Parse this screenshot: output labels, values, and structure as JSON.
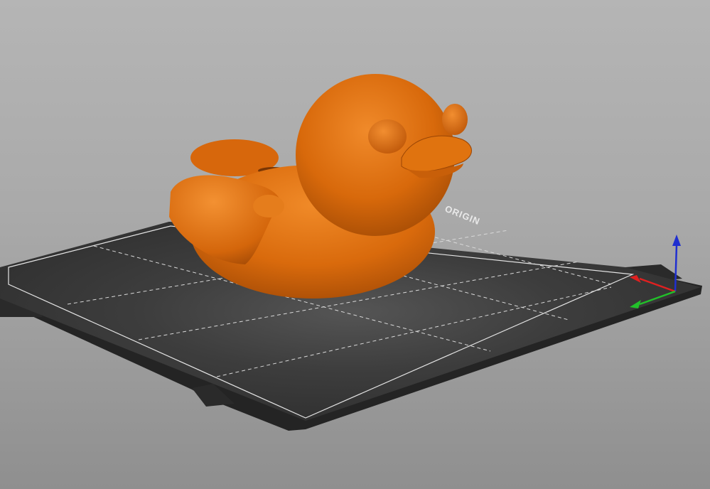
{
  "scene": {
    "bed_label": "ORIGIN",
    "model_color": "#e06f0c",
    "model_icon": "rubber-duck-model",
    "bed_color": "#3a3a3a",
    "background_color": "#a9a9a9",
    "axes": {
      "x_color": "#e02020",
      "y_color": "#22c02a",
      "z_color": "#1f2fd0"
    }
  }
}
